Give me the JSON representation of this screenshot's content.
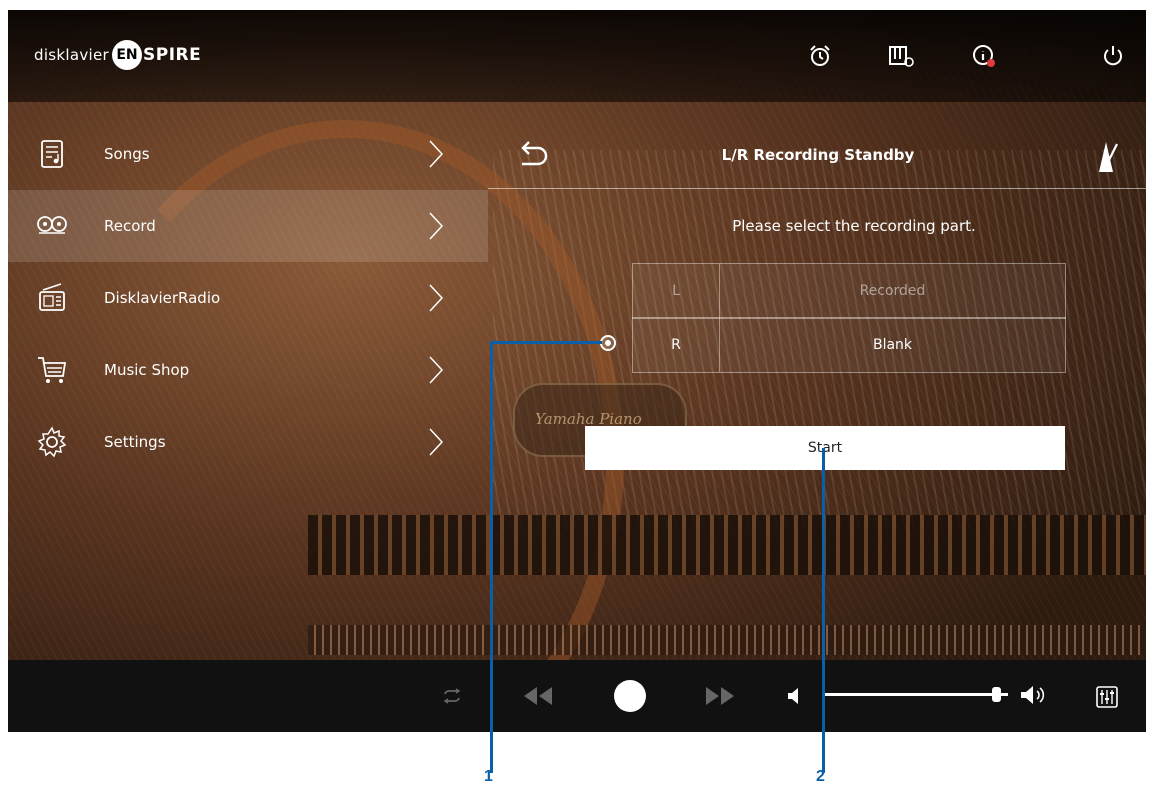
{
  "header": {
    "brand_prefix": "disklavier",
    "brand_badge": "EN",
    "brand_suffix": "SPIRE",
    "icons": [
      "alarm-clock-icon",
      "piano-settings-icon",
      "info-icon",
      "power-icon"
    ]
  },
  "sidebar": {
    "items": [
      {
        "label": "Songs",
        "icon": "songs-icon",
        "active": false
      },
      {
        "label": "Record",
        "icon": "reel-tape-icon",
        "active": true
      },
      {
        "label": "DisklavierRadio",
        "icon": "radio-icon",
        "active": false
      },
      {
        "label": "Music Shop",
        "icon": "cart-icon",
        "active": false
      },
      {
        "label": "Settings",
        "icon": "gear-icon",
        "active": false
      }
    ]
  },
  "panel": {
    "title": "L/R Recording Standby",
    "prompt": "Please select the recording part.",
    "parts": [
      {
        "part": "L",
        "status": "Recorded",
        "selected": false
      },
      {
        "part": "R",
        "status": "Blank",
        "selected": true
      }
    ],
    "start_label": "Start"
  },
  "transport": {
    "volume_level": 0.96,
    "icons": [
      "repeat-icon",
      "rewind-icon",
      "record-icon",
      "fast-forward-icon",
      "volume-low-icon",
      "volume-high-icon",
      "mixer-icon"
    ]
  },
  "callouts": [
    "1",
    "2"
  ],
  "colors": {
    "callout": "#0b5fa8",
    "start_button": "#ffffff",
    "bottom_bar": "#111111"
  }
}
